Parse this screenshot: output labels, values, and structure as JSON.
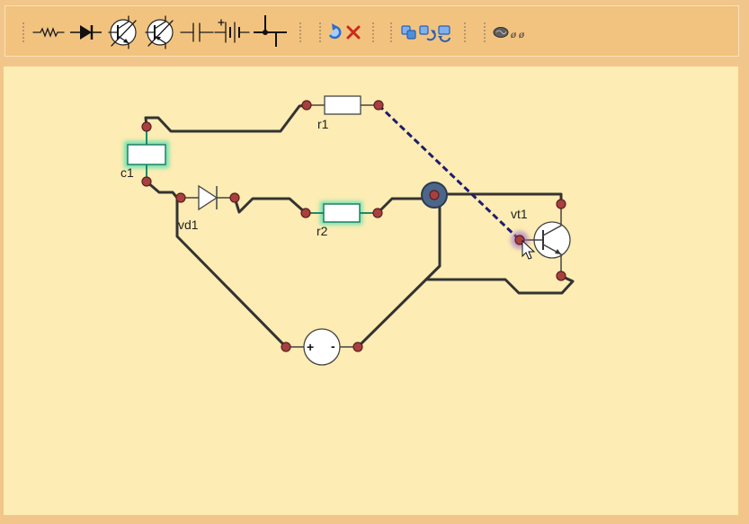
{
  "toolbar": {
    "component_tools": [
      {
        "icon": "resistor-icon"
      },
      {
        "icon": "diode-icon"
      },
      {
        "icon": "npn-transistor-icon"
      },
      {
        "icon": "pnp-transistor-icon"
      },
      {
        "icon": "capacitor-icon"
      },
      {
        "icon": "battery-icon"
      },
      {
        "icon": "junction-icon"
      }
    ],
    "edit_actions": [
      {
        "icon": "undo-icon"
      },
      {
        "icon": "delete-icon"
      }
    ],
    "view_actions": [
      {
        "icon": "copy-icon"
      },
      {
        "icon": "flip-icon"
      },
      {
        "icon": "rotate-icon"
      }
    ],
    "extras": {
      "icon": "brain-icon",
      "text": "ø ø"
    }
  },
  "circuit": {
    "c1": {
      "label": "c1",
      "selected": true
    },
    "r1": {
      "label": "r1",
      "selected": false
    },
    "vd1": {
      "label": "vd1",
      "selected": false
    },
    "r2": {
      "label": "r2",
      "selected": true
    },
    "vt1": {
      "label": "vt1",
      "selected": false,
      "base_terminal_hovered": true
    },
    "source": {
      "plus": "+",
      "minus": "-"
    }
  },
  "colors": {
    "app_background": "#f2c68a",
    "canvas_background": "#fdecb3",
    "wire": "#333333",
    "pending_wire_dashed": "#1d1d6e",
    "terminal": "#a84040",
    "junction_node": "#4b6689",
    "selection_glow": "#40e0b0",
    "hover_glow": "#9a6ad0",
    "delete_icon": "#cc2a1a",
    "undo_icon": "#2b6fcf"
  }
}
